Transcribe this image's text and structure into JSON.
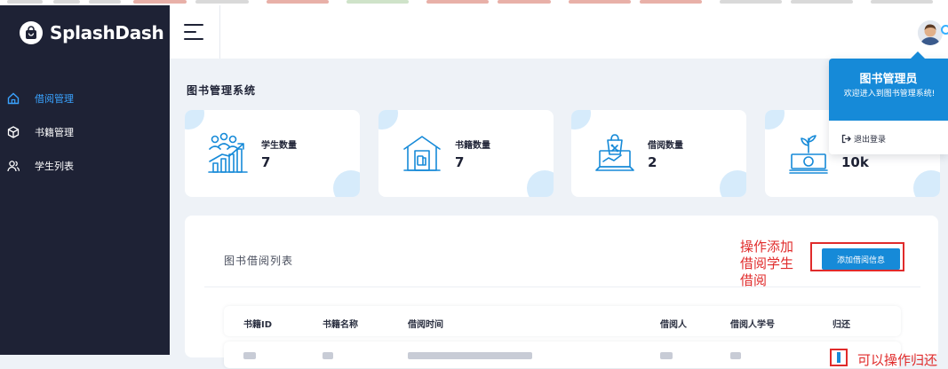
{
  "app": {
    "name": "SplashDash"
  },
  "sidebar": {
    "items": [
      {
        "label": "借阅管理",
        "icon": "home-icon",
        "active": true
      },
      {
        "label": "书籍管理",
        "icon": "box-icon",
        "active": false
      },
      {
        "label": "学生列表",
        "icon": "user-icon",
        "active": false
      }
    ]
  },
  "header": {
    "menu_icon": "hamburger-icon",
    "avatar_icon": "avatar"
  },
  "page": {
    "title": "图书管理系统"
  },
  "stats": [
    {
      "label": "学生数量",
      "value": "7",
      "icon": "students-growth-icon"
    },
    {
      "label": "书籍数量",
      "value": "7",
      "icon": "library-building-icon"
    },
    {
      "label": "借阅数量",
      "value": "2",
      "icon": "shopping-laptop-icon"
    },
    {
      "label": "",
      "value": "10k",
      "icon": "money-plant-icon"
    }
  ],
  "panel": {
    "title": "图书借阅列表",
    "add_button": "添加借阅信息",
    "annotation": "操作添加借阅学生借阅",
    "annotation_lines": [
      "操作添加",
      "借阅学生",
      "借阅"
    ],
    "columns": [
      "书籍ID",
      "书籍名称",
      "借阅时间",
      "借阅人",
      "借阅人学号",
      "归还"
    ],
    "row_annotation": "可以操作归还"
  },
  "dropdown": {
    "name": "图书管理员",
    "welcome": "欢迎进入到图书管理系统!",
    "logout": "退出登录"
  },
  "colors": {
    "sidebar_bg": "#1e2235",
    "accent": "#168ad8",
    "annotation_red": "#e02b2b",
    "page_bg": "#eef2f7"
  }
}
